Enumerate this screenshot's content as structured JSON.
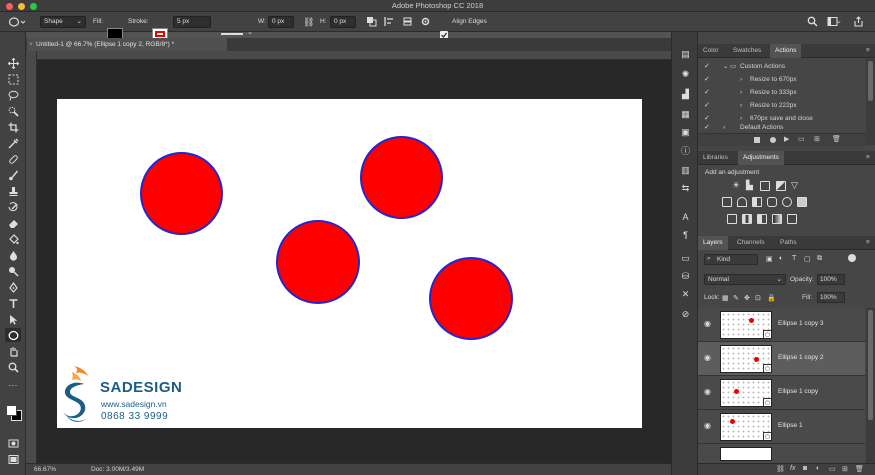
{
  "app": {
    "title": "Adobe Photoshop CC 2018"
  },
  "options_bar": {
    "mode": "Shape",
    "fill_label": "Fill:",
    "stroke_label": "Stroke:",
    "stroke_width": "5 px",
    "w_label": "W:",
    "w_value": "0 px",
    "h_label": "H:",
    "h_value": "0 px",
    "align_edges": "Align Edges"
  },
  "document": {
    "tab_title": "Untitled-1 @ 66.7% (Ellipse 1 copy 2, RGB/8*) *"
  },
  "status": {
    "zoom": "66.67%",
    "doc": "Doc: 3.00M/3.49M"
  },
  "panels": {
    "top_tabs": [
      "Color",
      "Swatches",
      "Actions"
    ],
    "actions": [
      {
        "label": "Custom Actions",
        "type": "folder"
      },
      {
        "label": "Resize to 670px",
        "type": "item"
      },
      {
        "label": "Resize to 333px",
        "type": "item"
      },
      {
        "label": "Resize to 222px",
        "type": "item"
      },
      {
        "label": "670px save and close",
        "type": "item"
      },
      {
        "label": "Default Actions",
        "type": "folder"
      }
    ],
    "mid_tabs": [
      "Libraries",
      "Adjustments"
    ],
    "add_adjustment": "Add an adjustment",
    "layer_tabs": [
      "Layers",
      "Channels",
      "Paths"
    ],
    "kind": "Kind",
    "blend_mode": "Normal",
    "opacity_label": "Opacity:",
    "opacity_value": "100%",
    "lock_label": "Lock:",
    "fill_label": "Fill:",
    "fill_value": "100%",
    "layers": [
      {
        "name": "Ellipse 1 copy 3",
        "selected": false
      },
      {
        "name": "Ellipse 1 copy 2",
        "selected": true
      },
      {
        "name": "Ellipse 1 copy",
        "selected": false
      },
      {
        "name": "Ellipse 1",
        "selected": false
      }
    ]
  },
  "watermark": {
    "brand": "SADESIGN",
    "url": "www.sadesign.vn",
    "phone": "0868 33 9999"
  },
  "colors": {
    "shape_fill": "#ff0000",
    "shape_stroke": "#2626cc",
    "brand": "#1a5e86",
    "accent": "#f08a24"
  }
}
